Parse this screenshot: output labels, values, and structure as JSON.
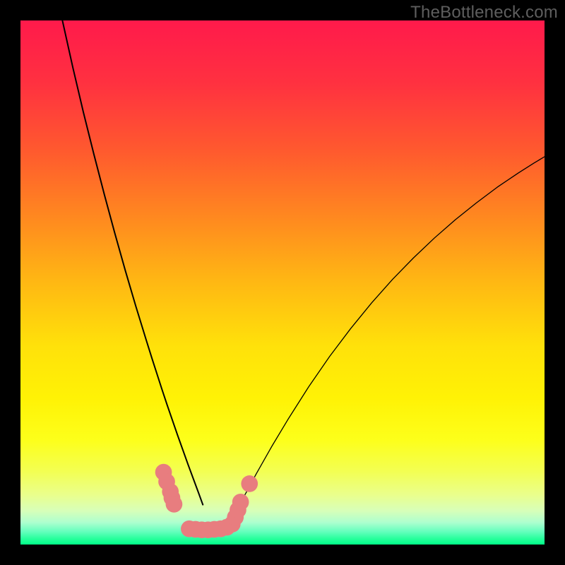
{
  "watermark": "TheBottleneck.com",
  "chart_data": {
    "type": "line",
    "title": "",
    "xlabel": "",
    "ylabel": "",
    "xlim": [
      0,
      100
    ],
    "ylim": [
      0,
      100
    ],
    "grid": false,
    "legend": false,
    "gradient_stops": [
      {
        "offset": 0.0,
        "color": "#ff1a4b"
      },
      {
        "offset": 0.12,
        "color": "#ff3140"
      },
      {
        "offset": 0.25,
        "color": "#ff5a2e"
      },
      {
        "offset": 0.38,
        "color": "#ff8a1f"
      },
      {
        "offset": 0.5,
        "color": "#ffb813"
      },
      {
        "offset": 0.62,
        "color": "#ffe10a"
      },
      {
        "offset": 0.72,
        "color": "#fff205"
      },
      {
        "offset": 0.8,
        "color": "#fdff1a"
      },
      {
        "offset": 0.86,
        "color": "#f3ff52"
      },
      {
        "offset": 0.905,
        "color": "#eaff8c"
      },
      {
        "offset": 0.935,
        "color": "#d8ffb8"
      },
      {
        "offset": 0.958,
        "color": "#adffcf"
      },
      {
        "offset": 0.975,
        "color": "#66ffbe"
      },
      {
        "offset": 0.988,
        "color": "#2bff9e"
      },
      {
        "offset": 1.0,
        "color": "#00ff87"
      }
    ],
    "series": [
      {
        "name": "left-curve",
        "x": [
          8.0,
          10.0,
          12.0,
          14.0,
          16.0,
          18.0,
          20.0,
          22.0,
          24.0,
          25.0,
          26.0,
          27.0,
          28.0,
          29.0,
          30.0,
          31.0,
          32.0,
          33.0,
          34.0,
          34.8
        ],
        "y": [
          100.0,
          91.0,
          82.5,
          74.5,
          66.8,
          59.4,
          52.3,
          45.5,
          39.0,
          35.8,
          32.7,
          29.6,
          26.6,
          23.7,
          20.8,
          18.0,
          15.2,
          12.5,
          9.8,
          7.6
        ],
        "stroke": "#000000",
        "stroke_width": 2
      },
      {
        "name": "right-curve",
        "x": [
          41.5,
          43.0,
          45.0,
          48.0,
          51.0,
          55.0,
          59.0,
          63.0,
          67.0,
          71.0,
          75.0,
          79.0,
          83.0,
          87.0,
          91.0,
          95.0,
          98.0,
          100.0
        ],
        "y": [
          7.2,
          9.8,
          13.5,
          18.8,
          23.8,
          30.1,
          35.9,
          41.2,
          46.1,
          50.6,
          54.7,
          58.5,
          62.0,
          65.2,
          68.2,
          70.9,
          72.8,
          74.0
        ],
        "stroke": "#000000",
        "stroke_width": 1.3
      }
    ],
    "markers": [
      {
        "x": 27.3,
        "y": 13.8,
        "r": 1.6
      },
      {
        "x": 27.9,
        "y": 12.0,
        "r": 1.6
      },
      {
        "x": 28.6,
        "y": 10.1,
        "r": 1.6
      },
      {
        "x": 28.9,
        "y": 8.9,
        "r": 1.6
      },
      {
        "x": 29.3,
        "y": 7.7,
        "r": 1.6
      },
      {
        "x": 32.2,
        "y": 3.0,
        "r": 1.6
      },
      {
        "x": 33.4,
        "y": 2.9,
        "r": 1.6
      },
      {
        "x": 34.6,
        "y": 2.8,
        "r": 1.6
      },
      {
        "x": 35.8,
        "y": 2.8,
        "r": 1.6
      },
      {
        "x": 37.0,
        "y": 2.9,
        "r": 1.6
      },
      {
        "x": 38.2,
        "y": 3.0,
        "r": 1.6
      },
      {
        "x": 39.4,
        "y": 3.3,
        "r": 1.6
      },
      {
        "x": 40.4,
        "y": 3.9,
        "r": 1.6
      },
      {
        "x": 41.0,
        "y": 5.2,
        "r": 1.6
      },
      {
        "x": 41.5,
        "y": 6.6,
        "r": 1.6
      },
      {
        "x": 42.0,
        "y": 8.1,
        "r": 1.6
      },
      {
        "x": 43.7,
        "y": 11.6,
        "r": 1.6
      }
    ],
    "marker_color": "#e87d7f"
  }
}
